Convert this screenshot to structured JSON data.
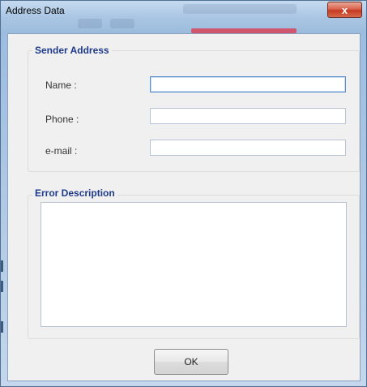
{
  "window": {
    "title": "Address Data",
    "close_glyph": "x"
  },
  "sender": {
    "group_title": "Sender Address",
    "name_label": "Name :",
    "phone_label": "Phone :",
    "email_label": "e-mail :",
    "name_value": "",
    "phone_value": "",
    "email_value": ""
  },
  "error": {
    "group_title": "Error Description",
    "value": ""
  },
  "buttons": {
    "ok_label": "OK"
  },
  "colors": {
    "group_title": "#1e3a8a",
    "close_button": "#c43a22"
  }
}
